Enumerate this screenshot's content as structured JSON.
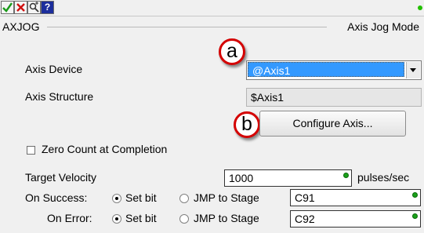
{
  "toolbar": {
    "ok_icon": "check-icon",
    "cancel_icon": "x-icon",
    "help_icon": "magnify-icon",
    "question_label": "?",
    "status_color": "#22c000"
  },
  "group": {
    "left_title": "AXJOG",
    "right_title": "Axis Jog Mode"
  },
  "callouts": {
    "a": "a",
    "b": "b"
  },
  "axis_device": {
    "label": "Axis Device",
    "value": "@Axis1"
  },
  "axis_structure": {
    "label": "Axis Structure",
    "value": "$Axis1"
  },
  "configure_button": {
    "label": "Configure Axis..."
  },
  "zero_count": {
    "label": "Zero Count at Completion",
    "checked": false
  },
  "target_velocity": {
    "label": "Target Velocity",
    "value": "1000",
    "unit": "pulses/sec"
  },
  "on_success": {
    "label": "On Success:",
    "opt_set": "Set bit",
    "opt_jmp": "JMP to Stage",
    "value": "C91"
  },
  "on_error": {
    "label": "On Error:",
    "opt_set": "Set bit",
    "opt_jmp": "JMP to Stage",
    "value": "C92"
  }
}
